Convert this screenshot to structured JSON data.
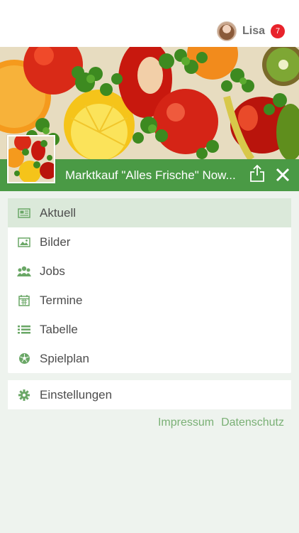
{
  "header": {
    "user_name": "Lisa",
    "notification_count": "7"
  },
  "page": {
    "title": "Marktkauf \"Alles Frische\" Now..."
  },
  "menu": {
    "items": [
      {
        "label": "Aktuell",
        "icon": "newspaper-icon",
        "active": true
      },
      {
        "label": "Bilder",
        "icon": "image-icon",
        "active": false
      },
      {
        "label": "Jobs",
        "icon": "people-icon",
        "active": false
      },
      {
        "label": "Termine",
        "icon": "calendar-icon",
        "active": false
      },
      {
        "label": "Tabelle",
        "icon": "list-icon",
        "active": false
      },
      {
        "label": "Spielplan",
        "icon": "soccer-ball-icon",
        "active": false
      }
    ],
    "settings_label": "Einstellungen"
  },
  "footer": {
    "impressum": "Impressum",
    "datenschutz": "Datenschutz"
  },
  "colors": {
    "accent_green": "#4a9a45",
    "active_row": "#dbe9da",
    "icon_green": "#6aa766",
    "link_green": "#7ab075",
    "badge_red": "#e8232b",
    "background": "#eef3ee"
  }
}
